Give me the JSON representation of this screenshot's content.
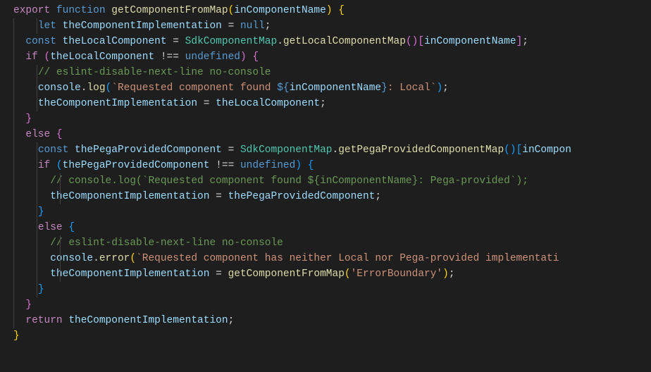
{
  "chart_data": {
    "type": "table",
    "title": "Code snippet: getComponentFromMap",
    "language": "javascript",
    "tokens": [
      [
        [
          "export ",
          "kw-export"
        ],
        [
          "function ",
          "kw-function"
        ],
        [
          "getComponentFromMap",
          "fn-name"
        ],
        [
          "(",
          "brace-y"
        ],
        [
          "inComponentName",
          "param"
        ],
        [
          ")",
          "brace-y"
        ],
        [
          " ",
          "punct"
        ],
        [
          "{",
          "brace-y"
        ]
      ],
      [
        [
          "    ",
          "punct"
        ],
        [
          "let ",
          "kw-function"
        ],
        [
          "theComponentImplementation",
          "param"
        ],
        [
          " = ",
          "op"
        ],
        [
          "null",
          "kw-null"
        ],
        [
          ";",
          "punct"
        ]
      ],
      [
        [
          "  ",
          "punct"
        ],
        [
          "const ",
          "kw-function"
        ],
        [
          "theLocalComponent",
          "param"
        ],
        [
          " = ",
          "op"
        ],
        [
          "SdkComponentMap",
          "class-name"
        ],
        [
          ".",
          "punct"
        ],
        [
          "getLocalComponentMap",
          "fn-name"
        ],
        [
          "()[",
          "brace-m"
        ],
        [
          "inComponentName",
          "param"
        ],
        [
          "]",
          "brace-m"
        ],
        [
          ";",
          "punct"
        ]
      ],
      [
        [
          "  ",
          "punct"
        ],
        [
          "if ",
          "kw-control"
        ],
        [
          "(",
          "brace-m"
        ],
        [
          "theLocalComponent",
          "param"
        ],
        [
          " !== ",
          "op"
        ],
        [
          "undefined",
          "kw-undef"
        ],
        [
          ")",
          "brace-m"
        ],
        [
          " ",
          "punct"
        ],
        [
          "{",
          "brace-m"
        ]
      ],
      [
        [
          "    ",
          "punct"
        ],
        [
          "// eslint-disable-next-line no-console",
          "comment"
        ]
      ],
      [
        [
          "    ",
          "punct"
        ],
        [
          "console",
          "param"
        ],
        [
          ".",
          "punct"
        ],
        [
          "log",
          "fn-name"
        ],
        [
          "(",
          "brace-b"
        ],
        [
          "`Requested component found ",
          "string"
        ],
        [
          "${",
          "tmpl-punct"
        ],
        [
          "inComponentName",
          "param"
        ],
        [
          "}",
          "tmpl-punct"
        ],
        [
          ": Local`",
          "string"
        ],
        [
          ")",
          "brace-b"
        ],
        [
          ";",
          "punct"
        ]
      ],
      [
        [
          "    ",
          "punct"
        ],
        [
          "theComponentImplementation",
          "param"
        ],
        [
          " = ",
          "op"
        ],
        [
          "theLocalComponent",
          "param"
        ],
        [
          ";",
          "punct"
        ]
      ],
      [
        [
          "  ",
          "punct"
        ],
        [
          "}",
          "brace-m"
        ]
      ],
      [
        [
          "  ",
          "punct"
        ],
        [
          "else ",
          "kw-control"
        ],
        [
          "{",
          "brace-m"
        ]
      ],
      [
        [
          "    ",
          "punct"
        ],
        [
          "const ",
          "kw-function"
        ],
        [
          "thePegaProvidedComponent",
          "param"
        ],
        [
          " = ",
          "op"
        ],
        [
          "SdkComponentMap",
          "class-name"
        ],
        [
          ".",
          "punct"
        ],
        [
          "getPegaProvidedComponentMap",
          "fn-name"
        ],
        [
          "()[",
          "brace-b"
        ],
        [
          "inCompon",
          "param"
        ]
      ],
      [
        [
          "    ",
          "punct"
        ],
        [
          "if ",
          "kw-control"
        ],
        [
          "(",
          "brace-b"
        ],
        [
          "thePegaProvidedComponent",
          "param"
        ],
        [
          " !== ",
          "op"
        ],
        [
          "undefined",
          "kw-undef"
        ],
        [
          ")",
          "brace-b"
        ],
        [
          " ",
          "punct"
        ],
        [
          "{",
          "brace-b"
        ]
      ],
      [
        [
          "      ",
          "punct"
        ],
        [
          "// console.log(`Requested component found ${inComponentName}: Pega-provided`);",
          "comment"
        ]
      ],
      [
        [
          "      ",
          "punct"
        ],
        [
          "theComponentImplementation",
          "param"
        ],
        [
          " = ",
          "op"
        ],
        [
          "thePegaProvidedComponent",
          "param"
        ],
        [
          ";",
          "punct"
        ]
      ],
      [
        [
          "    ",
          "punct"
        ],
        [
          "}",
          "brace-b"
        ]
      ],
      [
        [
          "    ",
          "punct"
        ],
        [
          "else ",
          "kw-control"
        ],
        [
          "{",
          "brace-b"
        ]
      ],
      [
        [
          "      ",
          "punct"
        ],
        [
          "// eslint-disable-next-line no-console",
          "comment"
        ]
      ],
      [
        [
          "      ",
          "punct"
        ],
        [
          "console",
          "param"
        ],
        [
          ".",
          "punct"
        ],
        [
          "error",
          "fn-name"
        ],
        [
          "(",
          "brace-y"
        ],
        [
          "`Requested component has neither Local nor Pega-provided implementati",
          "string"
        ]
      ],
      [
        [
          "      ",
          "punct"
        ],
        [
          "theComponentImplementation",
          "param"
        ],
        [
          " = ",
          "op"
        ],
        [
          "getComponentFromMap",
          "fn-name"
        ],
        [
          "(",
          "brace-y"
        ],
        [
          "'ErrorBoundary'",
          "string"
        ],
        [
          ")",
          "brace-y"
        ],
        [
          ";",
          "punct"
        ]
      ],
      [
        [
          "    ",
          "punct"
        ],
        [
          "}",
          "brace-b"
        ]
      ],
      [
        [
          "  ",
          "punct"
        ],
        [
          "}",
          "brace-m"
        ]
      ],
      [
        [
          "  ",
          "punct"
        ],
        [
          "return ",
          "kw-control"
        ],
        [
          "theComponentImplementation",
          "param"
        ],
        [
          ";",
          "punct"
        ]
      ],
      [
        [
          "}",
          "brace-y"
        ]
      ]
    ],
    "indents": [
      0,
      2,
      1,
      1,
      2,
      2,
      2,
      1,
      1,
      2,
      2,
      3,
      3,
      2,
      2,
      3,
      3,
      3,
      2,
      1,
      1,
      0
    ]
  }
}
